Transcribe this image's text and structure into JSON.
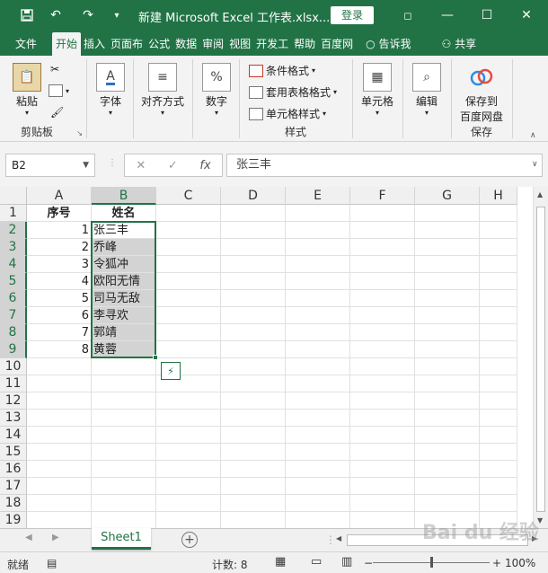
{
  "titlebar": {
    "title": "新建 Microsoft Excel 工作表.xlsx...",
    "login": "登录",
    "undo": "↶",
    "redo": "↷",
    "quick_menu": "▾",
    "minimize": "—",
    "restore": "◻",
    "maximize": "☐",
    "close": "✕"
  },
  "tabs": [
    "文件",
    "开始",
    "插入",
    "页面布",
    "公式",
    "数据",
    "审阅",
    "视图",
    "开发工",
    "帮助",
    "百度网"
  ],
  "tell_me": "告诉我",
  "share": "共享",
  "ribbon": {
    "paste": "粘贴",
    "clipboard": "剪贴板",
    "font": "字体",
    "alignment": "对齐方式",
    "number": "数字",
    "number_icon": "%",
    "conditional_format": "条件格式",
    "table_format": "套用表格格式",
    "cell_styles": "单元格样式",
    "styles": "样式",
    "cells": "单元格",
    "editing": "编辑",
    "save_to": "保存到",
    "baidu_disk": "百度网盘",
    "save": "保存"
  },
  "formula_bar": {
    "name_box": "B2",
    "cancel": "✕",
    "confirm": "✓",
    "fx": "fx",
    "value": "张三丰"
  },
  "columns": [
    "A",
    "B",
    "C",
    "D",
    "E",
    "F",
    "G",
    "H"
  ],
  "rows": [
    "1",
    "2",
    "3",
    "4",
    "5",
    "6",
    "7",
    "8",
    "9",
    "10",
    "11",
    "12",
    "13",
    "14",
    "15",
    "16",
    "17",
    "18",
    "19"
  ],
  "cells": {
    "A1": "序号",
    "B1": "姓名",
    "A2": "1",
    "B2": "张三丰",
    "A3": "2",
    "B3": "乔峰",
    "A4": "3",
    "B4": "令狐冲",
    "A5": "4",
    "B5": "欧阳无情",
    "A6": "5",
    "B6": "司马无敌",
    "A7": "6",
    "B7": "李寻欢",
    "A8": "7",
    "B8": "郭靖",
    "A9": "8",
    "B9": "黄蓉"
  },
  "sheets": {
    "active": "Sheet1",
    "add": "+"
  },
  "status": {
    "mode": "就绪",
    "count": "计数: 8",
    "zoom": "100%",
    "zoom_minus": "−",
    "zoom_plus": "+"
  },
  "watermark": "Bai du 经验",
  "colors": {
    "accent": "#217346",
    "selection": "#d3d3d3"
  }
}
